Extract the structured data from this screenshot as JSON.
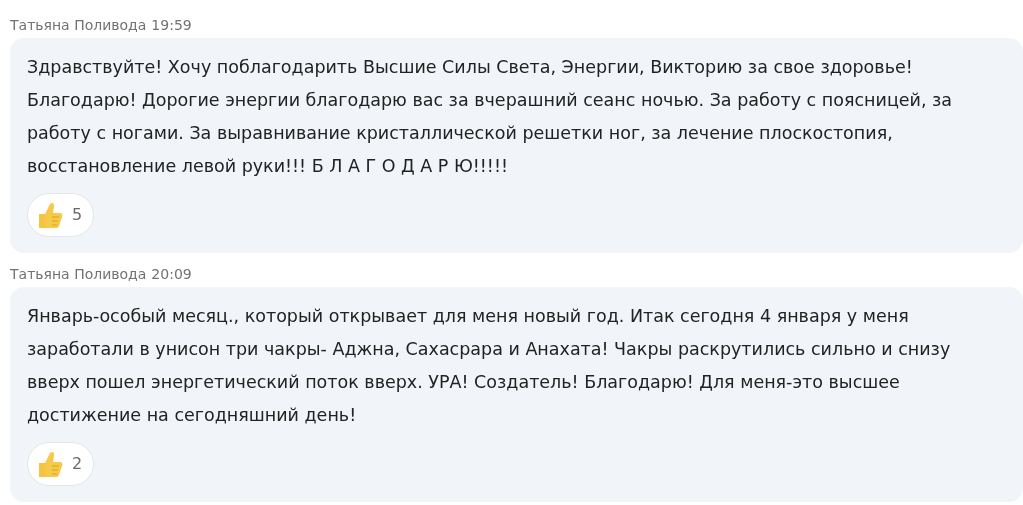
{
  "messages": [
    {
      "author": "Татьяна Поливода",
      "time": "19:59",
      "text": "Здравствуйте! Хочу поблагодарить Высшие Силы Света, Энергии, Викторию за свое здоровье! Благодарю! Дорогие энергии благодарю вас за вчерашний сеанс ночью. За работу с поясницей, за работу с ногами. За выравнивание кристаллической решетки ног, за лечение плоскостопия, восстановление левой руки!!! Б Л А Г О Д А Р Ю!!!!!",
      "reactions": [
        {
          "kind": "like",
          "count": "5"
        }
      ]
    },
    {
      "author": "Татьяна Поливода",
      "time": "20:09",
      "text": "Январь-особый месяц., который открывает для меня новый год. Итак сегодня 4 января у меня заработали в унисон три чакры- Аджна, Сахасрара и Анахата! Чакры раскрутились сильно и снизу вверх пошел энергетический поток вверх. УРА! Создатель! Благодарю! Для меня-это высшее достижение на сегодняшний день!",
      "reactions": [
        {
          "kind": "like",
          "count": "2"
        }
      ]
    }
  ]
}
